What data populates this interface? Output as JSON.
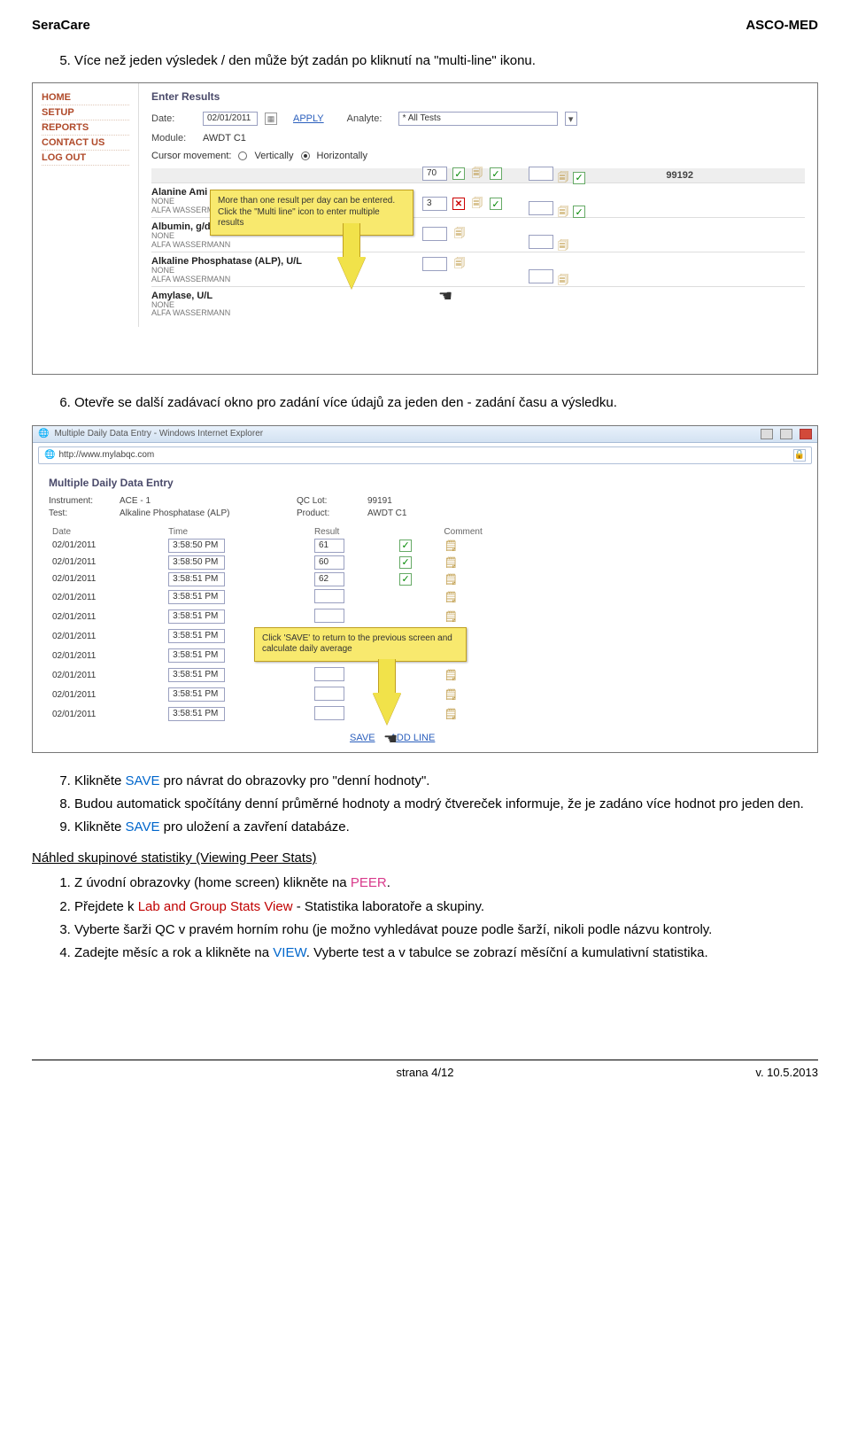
{
  "header": {
    "left": "SeraCare",
    "right": "ASCO-MED"
  },
  "step5": "Více než jeden výsledek / den může být zadán po kliknutí na \"multi-line\" ikonu.",
  "shot1": {
    "nav": [
      "HOME",
      "SETUP",
      "REPORTS",
      "CONTACT US",
      "LOG OUT"
    ],
    "title": "Enter Results",
    "date_label": "Date:",
    "date_val": "02/01/2011",
    "apply": "APPLY",
    "analyte_label": "Analyte:",
    "analyte_val": "* All Tests",
    "module_label": "Module:",
    "module_val": "AWDT C1",
    "cursor_label": "Cursor movement:",
    "opt_v": "Vertically",
    "opt_h": "Horizontally",
    "col_head": "99192",
    "tooltip": "More than one result per day can be entered. Click the \"Multi line\" icon to enter multiple results",
    "analytes": [
      {
        "name": "Alanine Ami",
        "sub1": "NONE",
        "sub2": "ALFA WASSERMANN",
        "val1": "70",
        "val2": ""
      },
      {
        "name": "Albumin, g/d",
        "sub1": "NONE",
        "sub2": "ALFA WASSERMANN",
        "val1": "3",
        "val2": ""
      },
      {
        "name": "Alkaline Phosphatase (ALP), U/L",
        "sub1": "NONE",
        "sub2": "ALFA WASSERMANN",
        "val1": "",
        "val2": ""
      },
      {
        "name": "Amylase, U/L",
        "sub1": "NONE",
        "sub2": "ALFA WASSERMANN",
        "val1": "",
        "val2": ""
      }
    ]
  },
  "step6": "Otevře se další zadávací okno pro zadání více údajů za jeden den - zadání času a výsledku.",
  "shot2": {
    "win_title": "Multiple Daily Data Entry - Windows Internet Explorer",
    "url": "http://www.mylabqc.com",
    "title": "Multiple Daily Data Entry",
    "instrument_label": "Instrument:",
    "instrument_val": "ACE - 1",
    "test_label": "Test:",
    "test_val": "Alkaline Phosphatase (ALP)",
    "qclot_label": "QC Lot:",
    "qclot_val": "99191",
    "product_label": "Product:",
    "product_val": "AWDT C1",
    "cols": {
      "date": "Date",
      "time": "Time",
      "result": "Result",
      "comment": "Comment"
    },
    "rows": [
      {
        "date": "02/01/2011",
        "time": "3:58:50 PM",
        "result": "61"
      },
      {
        "date": "02/01/2011",
        "time": "3:58:50 PM",
        "result": "60"
      },
      {
        "date": "02/01/2011",
        "time": "3:58:51 PM",
        "result": "62"
      },
      {
        "date": "02/01/2011",
        "time": "3:58:51 PM",
        "result": ""
      },
      {
        "date": "02/01/2011",
        "time": "3:58:51 PM",
        "result": ""
      },
      {
        "date": "02/01/2011",
        "time": "3:58:51 PM",
        "result": ""
      },
      {
        "date": "02/01/2011",
        "time": "3:58:51 PM",
        "result": ""
      },
      {
        "date": "02/01/2011",
        "time": "3:58:51 PM",
        "result": ""
      },
      {
        "date": "02/01/2011",
        "time": "3:58:51 PM",
        "result": ""
      },
      {
        "date": "02/01/2011",
        "time": "3:58:51 PM",
        "result": ""
      }
    ],
    "tooltip": "Click 'SAVE' to return to the previous screen and calculate daily average",
    "save": "SAVE",
    "addline": "ADD LINE"
  },
  "steps_after": {
    "s7a": "Klikněte ",
    "s7b": "SAVE",
    "s7c": " pro návrat do obrazovky pro \"denní hodnoty\".",
    "s8": "Budou automatick spočítány denní průměrné hodnoty a modrý čtvereček informuje, že je zadáno více hodnot pro jeden den.",
    "s9a": "Klikněte ",
    "s9b": "SAVE",
    "s9c": " pro uložení a zavření databáze."
  },
  "subhead": "Náhled skupinové statistiky (Viewing Peer Stats)",
  "peer_steps": {
    "p1a": "Z úvodní obrazovky (home screen) klikněte na ",
    "p1b": "PEER",
    "p1c": ".",
    "p2a": "Přejdete k ",
    "p2b": "Lab and Group Stats View",
    "p2c": " - Statistika laboratoře a skupiny.",
    "p3": "Vyberte šarži QC v pravém horním rohu (je možno vyhledávat pouze podle šarží, nikoli podle názvu kontroly.",
    "p4a": "Zadejte měsíc a rok a klikněte na ",
    "p4b": "VIEW",
    "p4c": ". Vyberte test a v tabulce se zobrazí měsíční a kumulativní statistika."
  },
  "footer": {
    "page": "strana 4/12",
    "ver": "v.  10.5.2013"
  }
}
